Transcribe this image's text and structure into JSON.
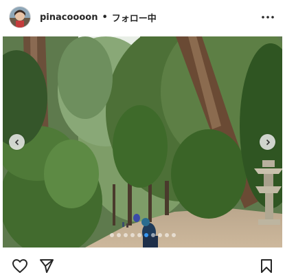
{
  "post": {
    "username": "pinacoooon",
    "separator": "•",
    "follow_status": "フォロー中"
  },
  "carousel": {
    "total_slides": 10,
    "active_slide": 5
  },
  "icons": {
    "more": "more-options-icon",
    "prev": "chevron-left-icon",
    "next": "chevron-right-icon",
    "like": "heart-icon",
    "share": "paper-plane-icon",
    "save": "bookmark-icon"
  },
  "colors": {
    "text": "#262626",
    "dot_active": "#3897f0",
    "dot_inactive": "#ffffffaa"
  }
}
